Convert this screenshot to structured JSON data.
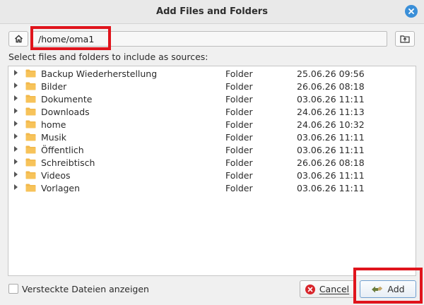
{
  "window": {
    "title": "Add Files and Folders"
  },
  "path_bar": {
    "current_path": "/home/oma1"
  },
  "instruction": "Select files and folders to include as sources:",
  "files": [
    {
      "name": "Backup Wiederherstellung",
      "type": "Folder",
      "modified": "25.06.26 09:56"
    },
    {
      "name": "Bilder",
      "type": "Folder",
      "modified": "26.06.26 08:18"
    },
    {
      "name": "Dokumente",
      "type": "Folder",
      "modified": "03.06.26 11:11"
    },
    {
      "name": "Downloads",
      "type": "Folder",
      "modified": "24.06.26 11:13"
    },
    {
      "name": "home",
      "type": "Folder",
      "modified": "24.06.26 10:32"
    },
    {
      "name": "Musik",
      "type": "Folder",
      "modified": "03.06.26 11:11"
    },
    {
      "name": "Öffentlich",
      "type": "Folder",
      "modified": "03.06.26 11:11"
    },
    {
      "name": "Schreibtisch",
      "type": "Folder",
      "modified": "26.06.26 08:18"
    },
    {
      "name": "Videos",
      "type": "Folder",
      "modified": "03.06.26 11:11"
    },
    {
      "name": "Vorlagen",
      "type": "Folder",
      "modified": "03.06.26 11:11"
    }
  ],
  "footer": {
    "show_hidden_label": "Versteckte Dateien anzeigen",
    "show_hidden_checked": false,
    "cancel_label": "Cancel",
    "add_label": "Add"
  },
  "colors": {
    "highlight": "#e0141c",
    "folder": "#f2b84b",
    "accent": "#3a8fd8"
  }
}
